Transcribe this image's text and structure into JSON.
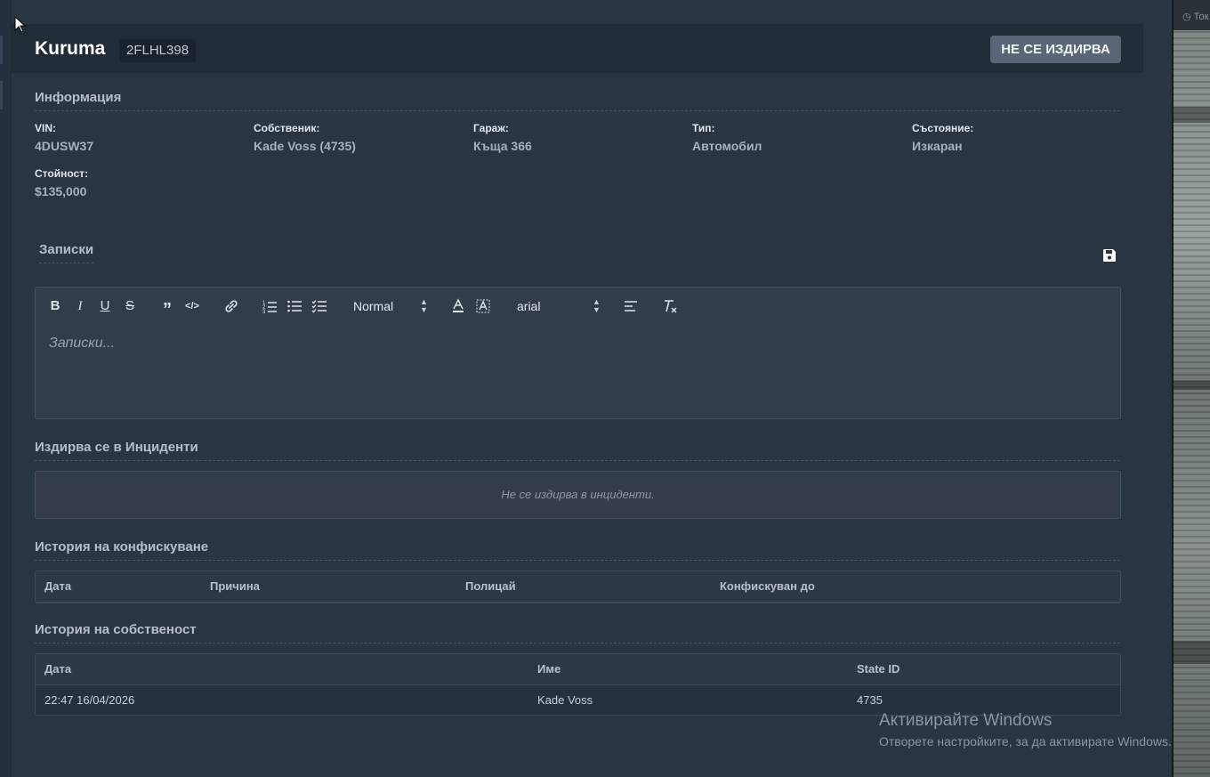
{
  "header": {
    "vehicle_name": "Kuruma",
    "plate": "2FLHL398",
    "wanted_status": "НЕ СЕ ИЗДИРВА"
  },
  "info": {
    "title": "Информация",
    "fields": [
      {
        "label": "VIN:",
        "value": "4DUSW37"
      },
      {
        "label": "Собственик:",
        "value": "Kade Voss (4735)"
      },
      {
        "label": "Гараж:",
        "value": "Къща 366"
      },
      {
        "label": "Тип:",
        "value": "Автомобил"
      },
      {
        "label": "Състояние:",
        "value": "Изкаран"
      },
      {
        "label": "Стойност:",
        "value": "$135,000"
      }
    ]
  },
  "notes": {
    "title": "Записки",
    "placeholder": "Записки...",
    "toolbar": {
      "header_select": "Normal",
      "font_select": "arial"
    },
    "icons": [
      "bold-icon",
      "italic-icon",
      "underline-icon",
      "strike-icon",
      "quote-icon",
      "code-icon",
      "link-icon",
      "ordered-list-icon",
      "bullet-list-icon",
      "checklist-icon",
      "text-color-icon",
      "background-color-icon",
      "align-icon",
      "clear-format-icon",
      "save-icon"
    ]
  },
  "incidents": {
    "title": "Издирва се в Инциденти",
    "empty_text": "Не се издирва в инциденти."
  },
  "impound": {
    "title": "История на конфискуване",
    "columns": [
      "Дата",
      "Причина",
      "Полицай",
      "Конфискуван до"
    ]
  },
  "ownership": {
    "title": "История на собственост",
    "columns": [
      "Дата",
      "Име",
      "State ID"
    ],
    "rows": [
      {
        "date": "22:47 16/04/2026",
        "name": "Kade Voss",
        "state_id": "4735"
      }
    ]
  },
  "background_topbar": "Ток",
  "watermark": {
    "line1": "Активирайте Windows",
    "line2": "Отворете настройките, за да активирате Windows."
  },
  "colors": {
    "panel_bg": "#2a3542",
    "header_bg": "#222c37",
    "button_bg": "#5a6675",
    "editor_bg": "#323d49"
  }
}
